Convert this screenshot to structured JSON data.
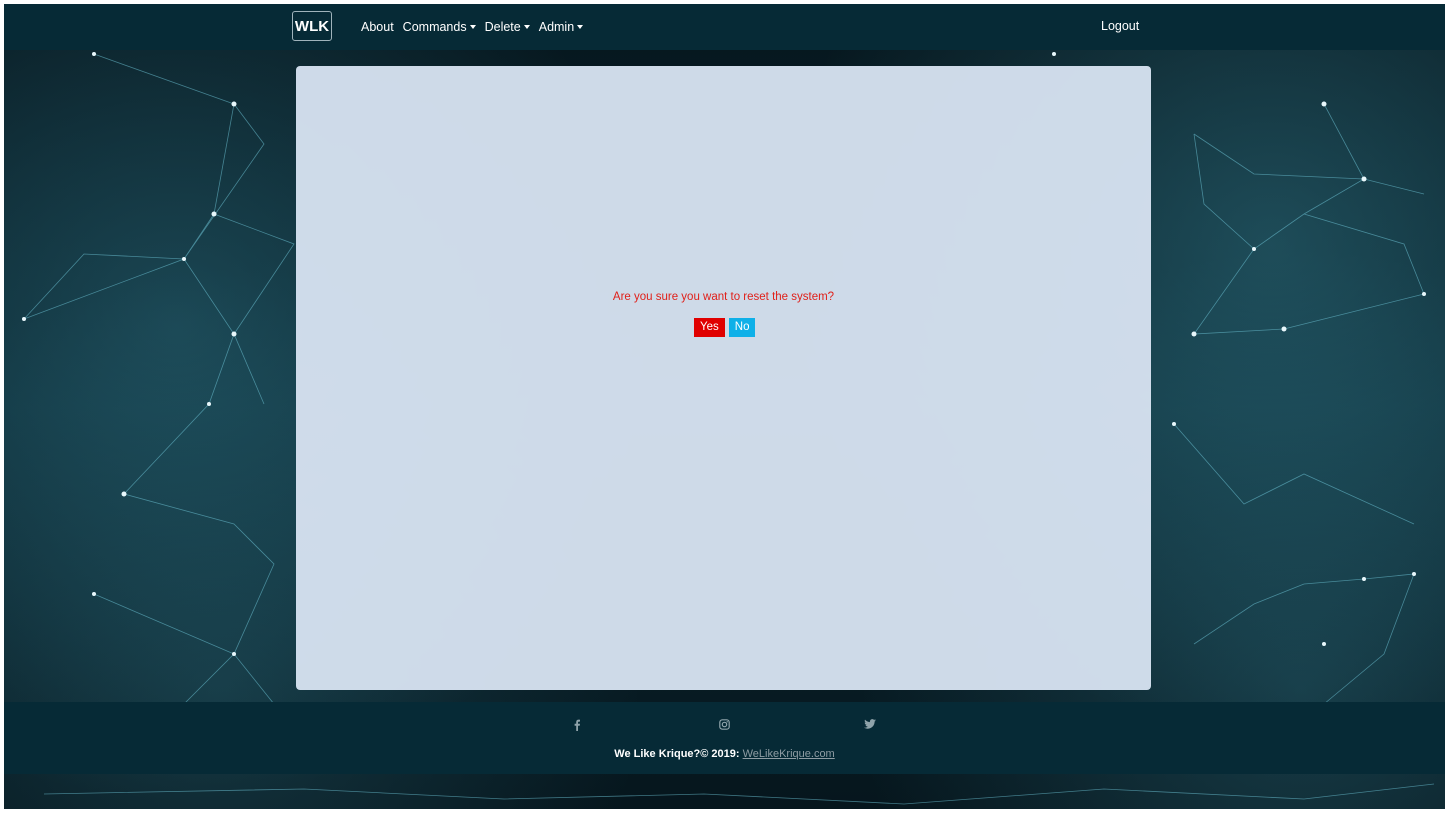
{
  "navbar": {
    "brand": "WLK",
    "links": [
      {
        "label": "About"
      },
      {
        "label": "Commands",
        "dropdown": true
      },
      {
        "label": "Delete",
        "dropdown": true
      },
      {
        "label": "Admin",
        "dropdown": true
      }
    ],
    "logout": "Logout"
  },
  "dialog": {
    "question": "Are you sure you want to reset the system?",
    "yes_label": "Yes",
    "no_label": "No"
  },
  "footer": {
    "social_icons": [
      "facebook-icon",
      "instagram-icon",
      "twitter-icon"
    ],
    "copyright_text": "We Like Krique?© 2019: ",
    "link_text": "WeLikeKrique.com"
  },
  "colors": {
    "navbar_bg": "#062a36",
    "panel_bg": "#d6e2f0",
    "question": "#e0201a",
    "yes_button": "#e00000",
    "no_button": "#0fb0e8"
  }
}
